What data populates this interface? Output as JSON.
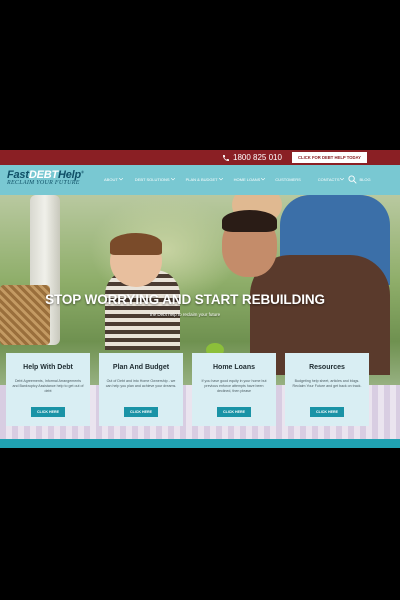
{
  "topbar": {
    "phone": "1800 825 010",
    "cta": "CLICK FOR DEBT HELP TODAY"
  },
  "logo": {
    "fast": "Fast",
    "debt": "DEBT",
    "help": "Help",
    "tagline": "RECLAIM YOUR FUTURE",
    "tm": "®"
  },
  "nav": {
    "items": [
      {
        "label": "ABOUT",
        "dropdown": true
      },
      {
        "label": "DEBT SOLUTIONS",
        "dropdown": true
      },
      {
        "label": "PLAN & BUDGET",
        "dropdown": true
      },
      {
        "label": "HOME LOANS",
        "dropdown": true
      },
      {
        "label": "CUSTOMERS",
        "dropdown": false
      },
      {
        "label": "CONTACTS",
        "dropdown": true
      },
      {
        "label": "BLOG",
        "dropdown": false
      }
    ]
  },
  "hero": {
    "title": "STOP WORRYING AND START REBUILDING",
    "subtitle": "the Debt help to reclaim your future"
  },
  "cards": [
    {
      "title": "Help With Debt",
      "text": "Debt Agreements, Informal Arrangements and Bankruptcy Assistance help to get out of debt",
      "button": "CLICK HERE"
    },
    {
      "title": "Plan And Budget",
      "text": "Out of Debt and into Home Ownership - we can help you plan and achieve your dreams.",
      "button": "CLICK HERE"
    },
    {
      "title": "Home Loans",
      "text": "If you have good equity in your home but previous enforce attempts have been declined, then please",
      "button": "CLICK HERE"
    },
    {
      "title": "Resources",
      "text": "Budgeting help sheet, articles and blogs. Reclaim Your Future and get back on track.",
      "button": "CLICK HERE"
    }
  ],
  "colors": {
    "topbar": "#8a1f24",
    "header": "#79c8d2",
    "accent": "#1a93a6",
    "card": "#d9eef3"
  },
  "icons": {
    "phone": "phone-icon",
    "search": "search-icon",
    "dropdown": "chevron-down-icon"
  }
}
